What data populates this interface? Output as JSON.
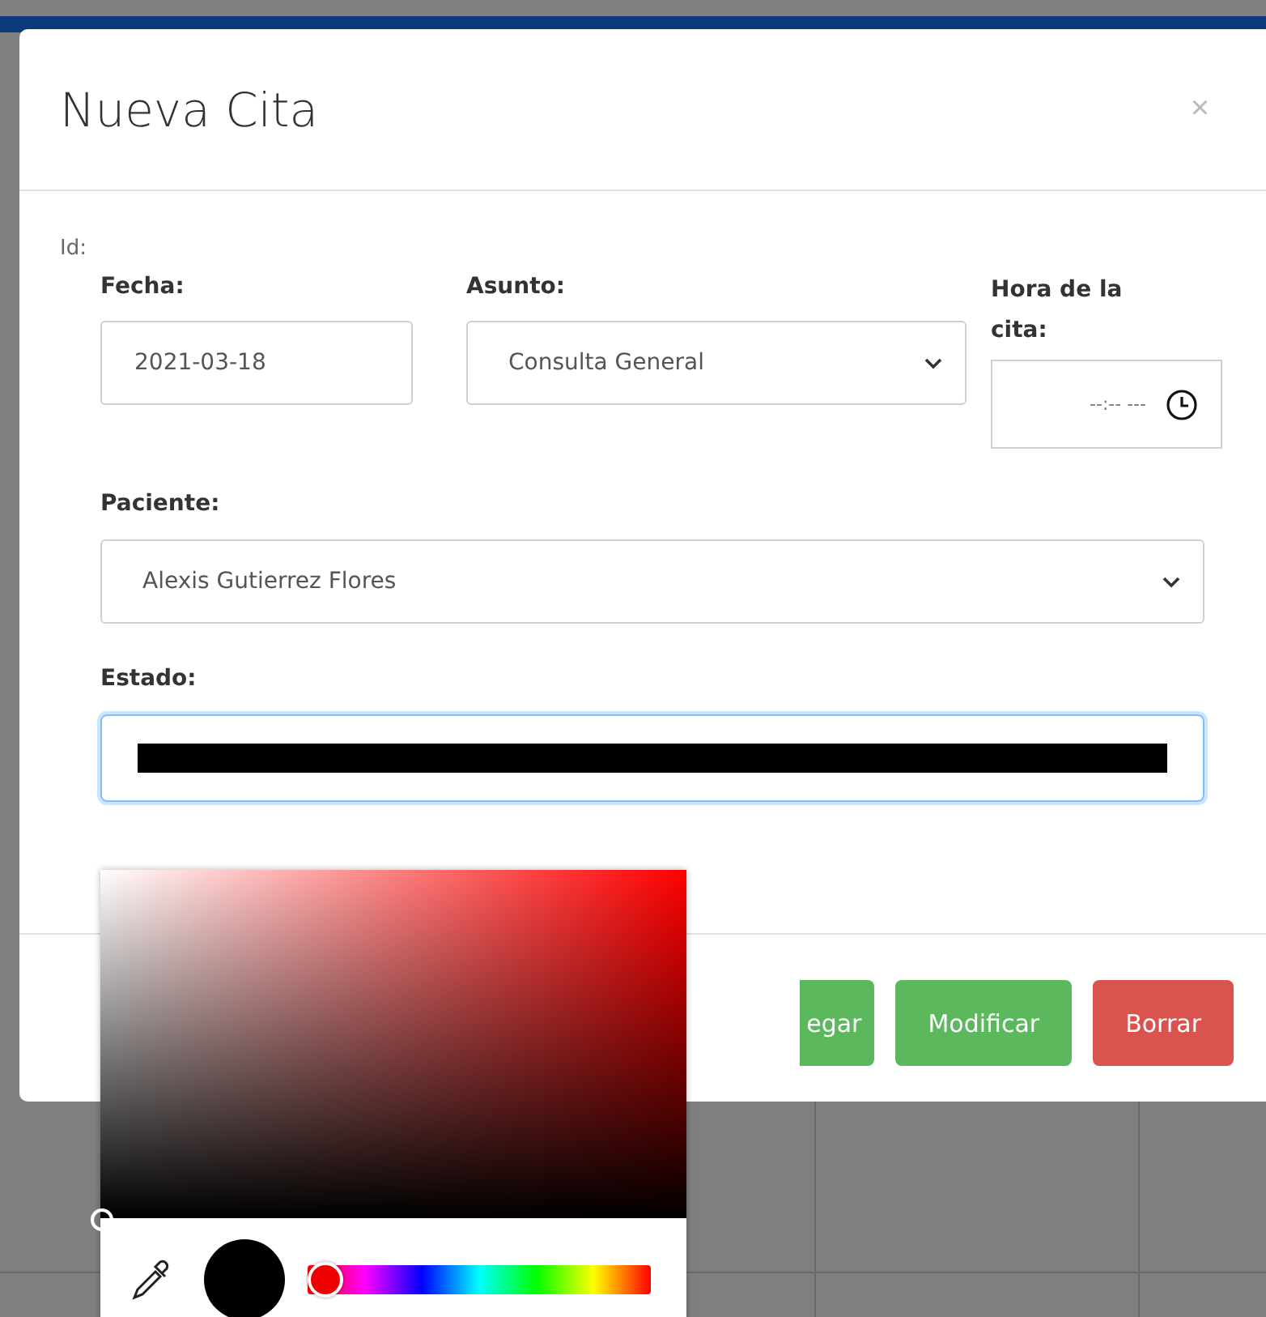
{
  "modal": {
    "title": "Nueva Cita",
    "close": "×",
    "id_label": "Id:",
    "fields": [
      {
        "label": "Fecha:",
        "kind": "text",
        "value": "2021-03-18"
      },
      {
        "label": "Asunto:",
        "kind": "select",
        "value": "Consulta General"
      },
      {
        "label": "Hora de la cita:",
        "kind": "time",
        "value": "--:-- ---"
      }
    ],
    "paciente": {
      "label": "Paciente:",
      "value": "Alexis Gutierrez Flores"
    },
    "estado": {
      "label": "Estado:",
      "color": "#000000"
    },
    "buttons": [
      {
        "label": "egar",
        "kind": "success"
      },
      {
        "label": "Modificar",
        "kind": "success"
      },
      {
        "label": "Borrar",
        "kind": "danger"
      }
    ]
  },
  "color_picker": {
    "hue": {
      "level": 0
    }
  }
}
